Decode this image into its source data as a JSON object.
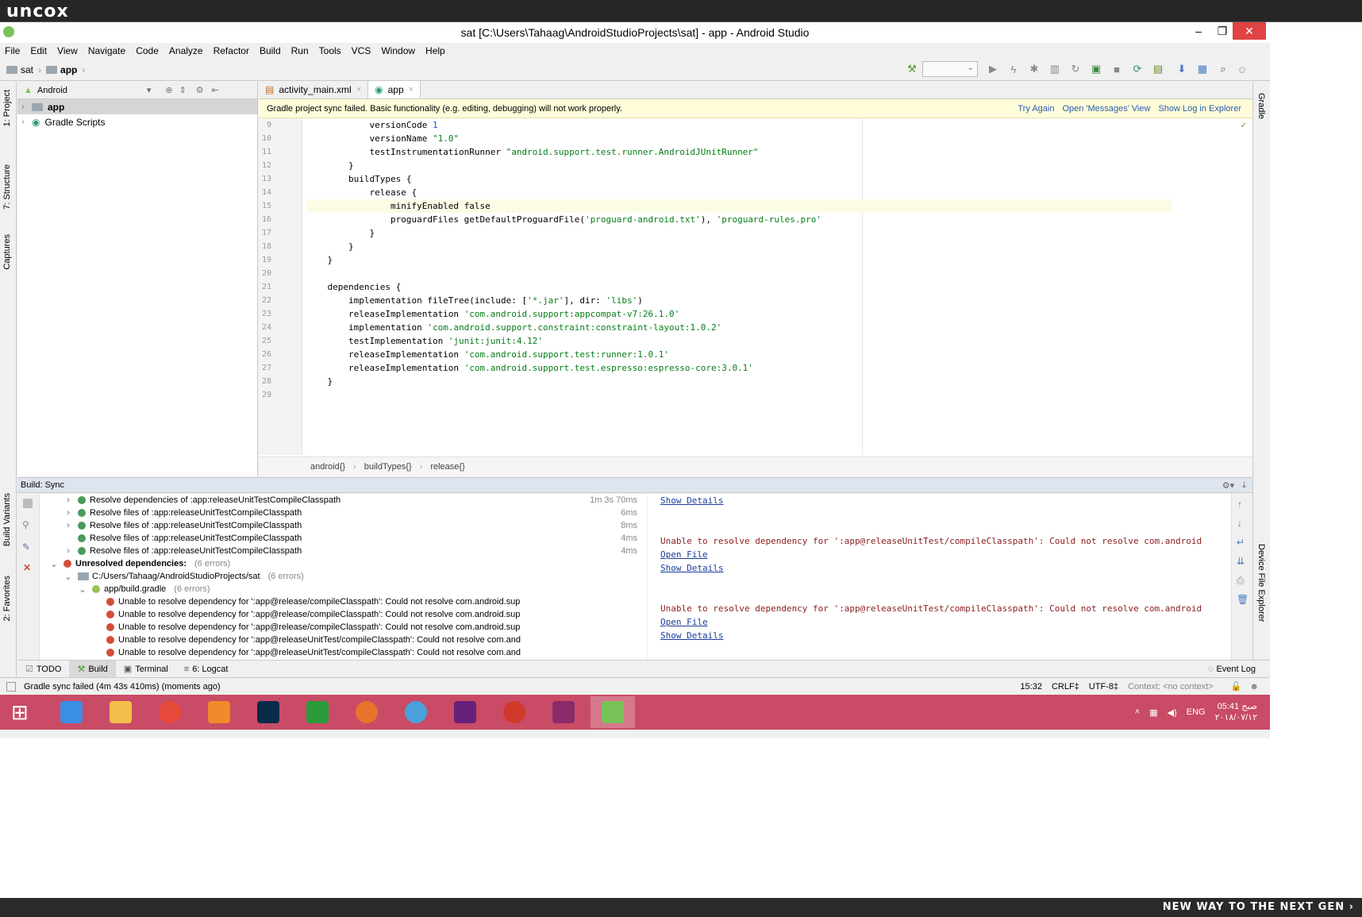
{
  "watermark": {
    "brand": "uncox",
    "slogan": "NEW WAY TO THE NEXT GEN ›"
  },
  "window": {
    "title": "sat [C:\\Users\\Tahaag\\AndroidStudioProjects\\sat] - app - Android Studio",
    "min": "–",
    "max": "❐",
    "close": "✕"
  },
  "menu": [
    "File",
    "Edit",
    "View",
    "Navigate",
    "Code",
    "Analyze",
    "Refactor",
    "Build",
    "Run",
    "Tools",
    "VCS",
    "Window",
    "Help"
  ],
  "nav": {
    "crumbs": [
      "sat",
      "app"
    ]
  },
  "project": {
    "view": "Android",
    "tree": [
      {
        "label": "app",
        "selected": true
      },
      {
        "label": "Gradle Scripts",
        "selected": false
      }
    ]
  },
  "left_tabs": [
    "1: Project",
    "7: Structure",
    "Captures",
    "Build Variants",
    "2: Favorites"
  ],
  "right_tabs": [
    "Gradle",
    "Device File Explorer"
  ],
  "editor": {
    "tabs": [
      {
        "label": "activity_main.xml",
        "active": false
      },
      {
        "label": "app",
        "active": true
      }
    ],
    "banner": {
      "message": "Gradle project sync failed. Basic functionality (e.g. editing, debugging) will not work properly.",
      "links": [
        "Try Again",
        "Open 'Messages' View",
        "Show Log in Explorer"
      ]
    },
    "lines": [
      {
        "n": "9",
        "parts": [
          {
            "t": "            versionCode "
          },
          {
            "t": "1",
            "c": "num"
          }
        ]
      },
      {
        "n": "10",
        "parts": [
          {
            "t": "            versionName "
          },
          {
            "t": "\"1.0\"",
            "c": "str"
          }
        ]
      },
      {
        "n": "11",
        "parts": [
          {
            "t": "            testInstrumentationRunner "
          },
          {
            "t": "\"android.support.test.runner.AndroidJUnitRunner\"",
            "c": "str"
          }
        ]
      },
      {
        "n": "12",
        "parts": [
          {
            "t": "        }"
          }
        ]
      },
      {
        "n": "13",
        "parts": [
          {
            "t": "        buildTypes {"
          }
        ]
      },
      {
        "n": "14",
        "parts": [
          {
            "t": "            release {"
          }
        ]
      },
      {
        "n": "15",
        "hl": true,
        "parts": [
          {
            "t": "                minifyEnabled "
          },
          {
            "t": "false"
          }
        ]
      },
      {
        "n": "16",
        "parts": [
          {
            "t": "                proguardFiles getDefaultProguardFile("
          },
          {
            "t": "'proguard-android.txt'",
            "c": "str"
          },
          {
            "t": "), "
          },
          {
            "t": "'proguard-rules.pro'",
            "c": "str"
          }
        ]
      },
      {
        "n": "17",
        "parts": [
          {
            "t": "            }"
          }
        ]
      },
      {
        "n": "18",
        "parts": [
          {
            "t": "        }"
          }
        ]
      },
      {
        "n": "19",
        "parts": [
          {
            "t": "    }"
          }
        ]
      },
      {
        "n": "20",
        "parts": [
          {
            "t": ""
          }
        ]
      },
      {
        "n": "21",
        "parts": [
          {
            "t": "    dependencies {"
          }
        ]
      },
      {
        "n": "22",
        "parts": [
          {
            "t": "        implementation fileTree(include: ["
          },
          {
            "t": "'*.jar'",
            "c": "str"
          },
          {
            "t": "], dir: "
          },
          {
            "t": "'libs'",
            "c": "str"
          },
          {
            "t": ")"
          }
        ]
      },
      {
        "n": "23",
        "parts": [
          {
            "t": "        releaseImplementation "
          },
          {
            "t": "'com.android.support:appcompat-v7:26.1.0'",
            "c": "str"
          }
        ]
      },
      {
        "n": "24",
        "parts": [
          {
            "t": "        implementation "
          },
          {
            "t": "'com.android.support.constraint:constraint-layout:1.0.2'",
            "c": "str"
          }
        ]
      },
      {
        "n": "25",
        "parts": [
          {
            "t": "        testImplementation "
          },
          {
            "t": "'junit:junit:4.12'",
            "c": "str"
          }
        ]
      },
      {
        "n": "26",
        "parts": [
          {
            "t": "        releaseImplementation "
          },
          {
            "t": "'com.android.support.test:runner:1.0.1'",
            "c": "str"
          }
        ]
      },
      {
        "n": "27",
        "parts": [
          {
            "t": "        releaseImplementation "
          },
          {
            "t": "'com.android.support.test.espresso:espresso-core:3.0.1'",
            "c": "str"
          }
        ]
      },
      {
        "n": "28",
        "parts": [
          {
            "t": "    }"
          }
        ]
      },
      {
        "n": "29",
        "parts": [
          {
            "t": ""
          }
        ]
      }
    ],
    "breadcrumb": [
      "android{}",
      "buildTypes{}",
      "release{}"
    ]
  },
  "build": {
    "title": "Build: Sync",
    "rows": [
      {
        "indent": 1,
        "arrow": "›",
        "icon": "ok",
        "text": "Resolve dependencies of :app:releaseUnitTestCompileClasspath",
        "time": "1m 3s 70ms"
      },
      {
        "indent": 1,
        "arrow": "›",
        "icon": "ok",
        "text": "Resolve files of :app:releaseUnitTestCompileClasspath",
        "time": "6ms"
      },
      {
        "indent": 1,
        "arrow": "›",
        "icon": "ok",
        "text": "Resolve files of :app:releaseUnitTestCompileClasspath",
        "time": "8ms"
      },
      {
        "indent": 1,
        "arrow": "",
        "icon": "ok",
        "text": "Resolve files of :app:releaseUnitTestCompileClasspath",
        "time": "4ms"
      },
      {
        "indent": 1,
        "arrow": "›",
        "icon": "ok",
        "text": "Resolve files of :app:releaseUnitTestCompileClasspath",
        "time": "4ms"
      },
      {
        "indent": 0,
        "arrow": "⌄",
        "icon": "err",
        "text": "Unresolved dependencies:",
        "bold": true,
        "note": "(6 errors)"
      },
      {
        "indent": 1,
        "arrow": "⌄",
        "icon": "folder",
        "text": "C:/Users/Tahaag/AndroidStudioProjects/sat",
        "note": "(6 errors)"
      },
      {
        "indent": 2,
        "arrow": "⌄",
        "icon": "gradle",
        "text": "app/build.gradle",
        "note": "(6 errors)"
      },
      {
        "indent": 3,
        "arrow": "",
        "icon": "err",
        "text": "Unable to resolve dependency for ':app@release/compileClasspath': Could not resolve com.android.sup"
      },
      {
        "indent": 3,
        "arrow": "",
        "icon": "err",
        "text": "Unable to resolve dependency for ':app@release/compileClasspath': Could not resolve com.android.sup"
      },
      {
        "indent": 3,
        "arrow": "",
        "icon": "err",
        "text": "Unable to resolve dependency for ':app@release/compileClasspath': Could not resolve com.android.sup"
      },
      {
        "indent": 3,
        "arrow": "",
        "icon": "err",
        "text": "Unable to resolve dependency for ':app@releaseUnitTest/compileClasspath': Could not resolve com.and"
      },
      {
        "indent": 3,
        "arrow": "",
        "icon": "err",
        "text": "Unable to resolve dependency for ':app@releaseUnitTest/compileClasspath': Could not resolve com.and"
      },
      {
        "indent": 3,
        "arrow": "",
        "icon": "err",
        "text": "Unable to resolve dependency for ':app@releaseUnitTest/compileClasspath': Could not resolve com.and"
      }
    ],
    "output": [
      {
        "kind": "link",
        "text": "Show Details"
      },
      {
        "kind": "blank",
        "text": ""
      },
      {
        "kind": "blank",
        "text": ""
      },
      {
        "kind": "err",
        "text": "Unable to resolve dependency for ':app@releaseUnitTest/compileClasspath': Could not resolve com.android"
      },
      {
        "kind": "link",
        "text": "Open File"
      },
      {
        "kind": "link",
        "text": "Show Details"
      },
      {
        "kind": "blank",
        "text": ""
      },
      {
        "kind": "blank",
        "text": ""
      },
      {
        "kind": "err",
        "text": "Unable to resolve dependency for ':app@releaseUnitTest/compileClasspath': Could not resolve com.android"
      },
      {
        "kind": "link",
        "text": "Open File"
      },
      {
        "kind": "link",
        "text": "Show Details"
      }
    ]
  },
  "toolwindows": [
    "TODO",
    "Build",
    "Terminal",
    "6: Logcat"
  ],
  "event_log": "Event Log",
  "status": {
    "message": "Gradle sync failed (4m 43s 410ms) (moments ago)",
    "position": "15:32",
    "line_sep": "CRLF‡",
    "encoding": "UTF-8‡",
    "context": "Context: <no context>"
  },
  "taskbar": {
    "apps": [
      {
        "name": "start",
        "color": "#ffffff"
      },
      {
        "name": "internet-explorer",
        "color": "#3a8ee6"
      },
      {
        "name": "file-explorer",
        "color": "#f2c04a"
      },
      {
        "name": "chrome",
        "color": "#e84a3a"
      },
      {
        "name": "media-player",
        "color": "#f08a2a"
      },
      {
        "name": "photoshop",
        "color": "#0a2a4a"
      },
      {
        "name": "store",
        "color": "#2a9a3a"
      },
      {
        "name": "firefox",
        "color": "#e8742a"
      },
      {
        "name": "globe-app",
        "color": "#4aa0d8"
      },
      {
        "name": "visual-studio",
        "color": "#68217a"
      },
      {
        "name": "psiphon",
        "color": "#d03a2a"
      },
      {
        "name": "winrar",
        "color": "#8a2a6a"
      },
      {
        "name": "android-studio",
        "color": "#78c257"
      }
    ],
    "lang": "ENG",
    "time": "05:41 صبح",
    "date": "۲۰۱۸/۰۷/۱۲"
  }
}
